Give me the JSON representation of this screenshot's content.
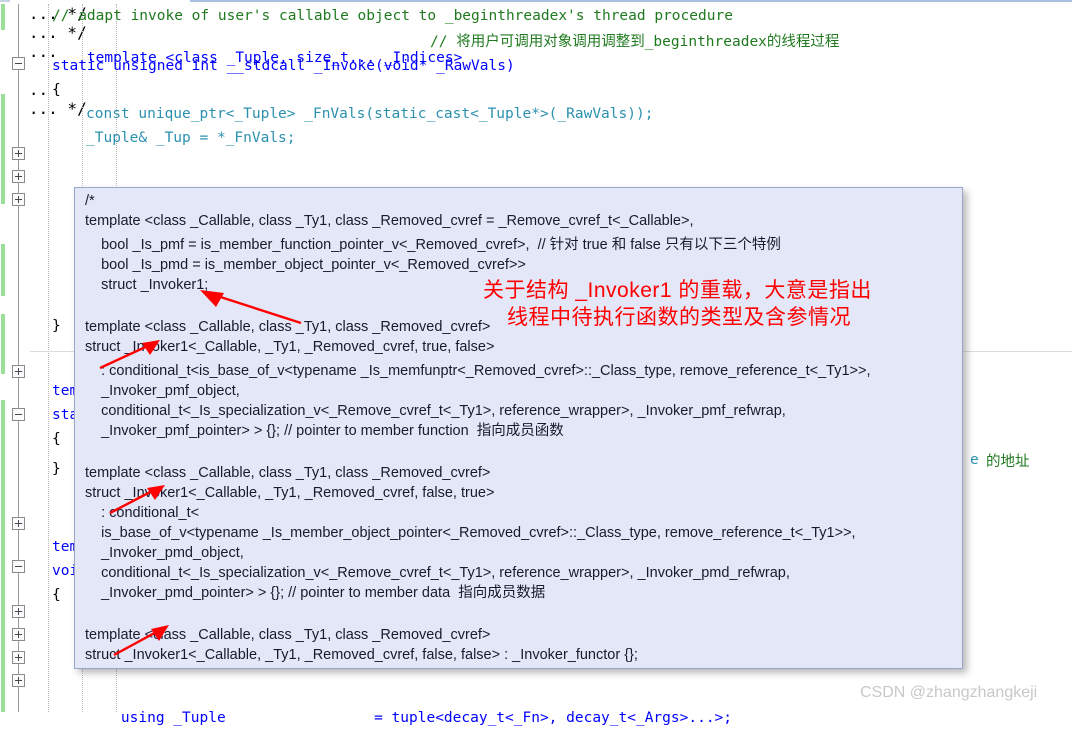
{
  "colors": {
    "overlay_bg": "#e3e7f7",
    "overlay_border": "#9aa8c8",
    "annotation_red": "#ff0000",
    "comment_green": "#1f7a1f",
    "keyword_blue": "#0000ff",
    "type_teal": "#2b91af",
    "change_bar_green": "#9ae09a",
    "watermark_gray": "#c8c8c8"
  },
  "editor": {
    "code_lines": [
      {
        "text": "// adapt invoke of user's callable object to _beginthreadex's thread procedure"
      },
      {
        "text": "template <class _Tuple, size_t... _Indices>"
      },
      {
        "text": "// 将用户可调用对象调用调整到_beginthreadex的线程过程"
      },
      {
        "text": "static unsigned int __stdcall _Invoke(void* _RawVals)"
      },
      {
        "text": "{"
      },
      {
        "text": "const unique_ptr<_Tuple> _FnVals(static_cast<_Tuple*>(_RawVals));"
      },
      {
        "text": "_Tuple& _Tup = *_FnVals;"
      },
      {
        "text": "}"
      },
      {
        "text": "tem"
      },
      {
        "text": "sta"
      },
      {
        "text": "{"
      },
      {
        "text": "}"
      },
      {
        "text": "tem"
      },
      {
        "text": "voi"
      },
      {
        "text": "{"
      },
      {
        "text": "using _Tuple                 = tuple<decay_t<_Fn>, decay_t<_Args>...>;"
      }
    ],
    "collapsed_regions": [
      {
        "label": "/*  ...  */"
      },
      {
        "label": "/*  ...  */"
      },
      {
        "label": "/*  ..."
      },
      {
        "label": "/*"
      },
      {
        "label": "/*  .."
      },
      {
        "label": "/*  ...  */"
      }
    ],
    "right_fragment_code": "e",
    "right_fragment_comment": "的地址"
  },
  "overlay": {
    "lines": [
      "/*",
      "template <class _Callable, class _Ty1, class _Removed_cvref = _Remove_cvref_t<_Callable>,",
      "    bool _Is_pmf = is_member_function_pointer_v<_Removed_cvref>,  // 针对 true 和 false 只有以下三个特例",
      "    bool _Is_pmd = is_member_object_pointer_v<_Removed_cvref>>",
      "    struct _Invoker1;",
      "",
      "template <class _Callable, class _Ty1, class _Removed_cvref>",
      "struct _Invoker1<_Callable, _Ty1, _Removed_cvref, true, false>",
      "    : conditional_t<is_base_of_v<typename _Is_memfunptr<_Removed_cvref>::_Class_type, remove_reference_t<_Ty1>>,",
      "    _Invoker_pmf_object,",
      "    conditional_t<_Is_specialization_v<_Remove_cvref_t<_Ty1>, reference_wrapper>, _Invoker_pmf_refwrap,",
      "    _Invoker_pmf_pointer> > {}; // pointer to member function  指向成员函数",
      "",
      "template <class _Callable, class _Ty1, class _Removed_cvref>",
      "struct _Invoker1<_Callable, _Ty1, _Removed_cvref, false, true>",
      "    : conditional_t<",
      "    is_base_of_v<typename _Is_member_object_pointer<_Removed_cvref>::_Class_type, remove_reference_t<_Ty1>>,",
      "    _Invoker_pmd_object,",
      "    conditional_t<_Is_specialization_v<_Remove_cvref_t<_Ty1>, reference_wrapper>, _Invoker_pmd_refwrap,",
      "    _Invoker_pmd_pointer> > {}; // pointer to member data  指向成员数据",
      "",
      "template <class _Callable, class _Ty1, class _Removed_cvref>",
      "struct _Invoker1<_Callable, _Ty1, _Removed_cvref, false, false> : _Invoker_functor {};",
      "*/"
    ]
  },
  "annotations": {
    "line1": "关于结构 _Invoker1 的重载，大意是指出",
    "line2": "线程中待执行函数的类型及含参情况"
  },
  "watermark": {
    "text": "CSDN @zhangzhangkeji"
  }
}
